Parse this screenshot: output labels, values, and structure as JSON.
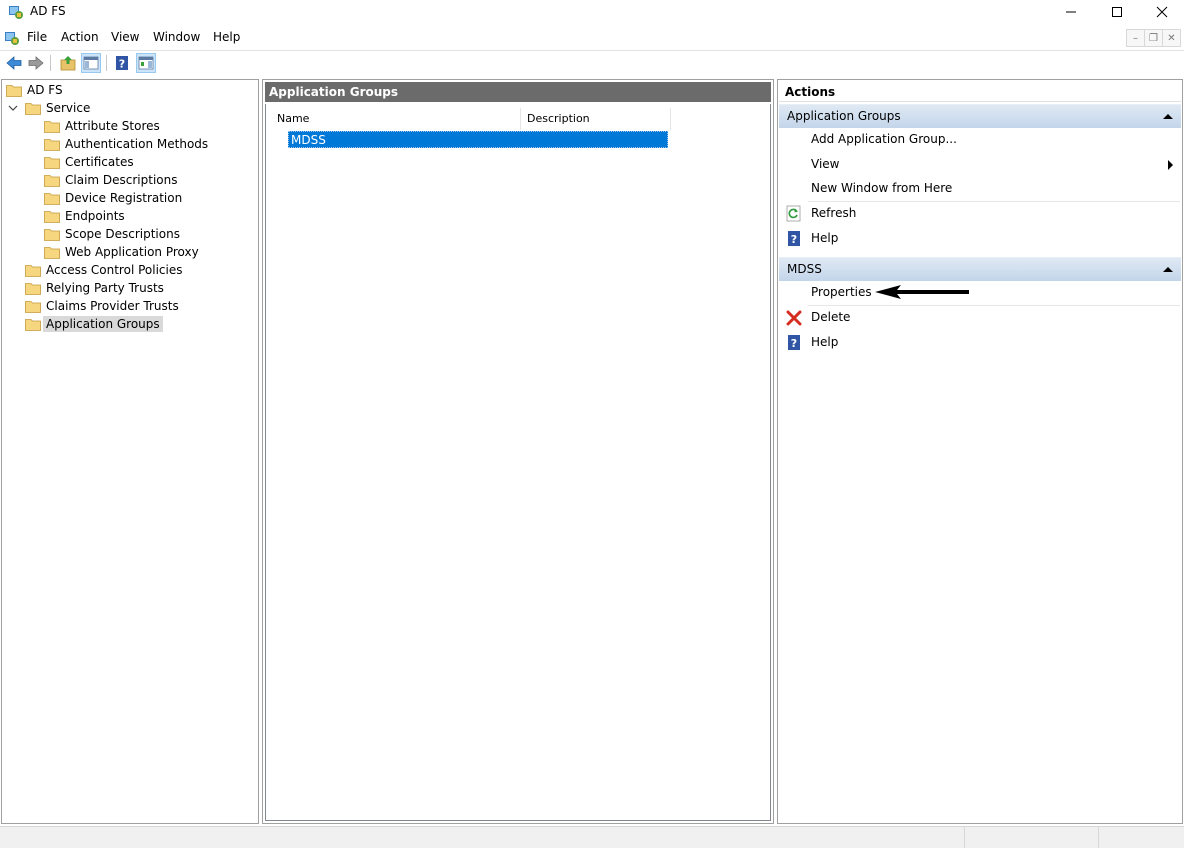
{
  "window": {
    "title": "AD FS",
    "icon": "adfs-icon",
    "controls": [
      "minimize-icon",
      "maximize-icon",
      "close-icon"
    ]
  },
  "menu": {
    "items": [
      "File",
      "Action",
      "View",
      "Window",
      "Help"
    ]
  },
  "toolbar": {
    "buttons": [
      "back-arrow-icon",
      "forward-arrow-icon",
      "up-folder-icon",
      "show-hide-tree-icon",
      "help-icon",
      "show-hide-action-pane-icon"
    ]
  },
  "tree": {
    "root": "AD FS",
    "service": "Service",
    "service_children": [
      "Attribute Stores",
      "Authentication Methods",
      "Certificates",
      "Claim Descriptions",
      "Device Registration",
      "Endpoints",
      "Scope Descriptions",
      "Web Application Proxy"
    ],
    "top_level": [
      "Access Control Policies",
      "Relying Party Trusts",
      "Claims Provider Trusts",
      "Application Groups"
    ],
    "selected": "Application Groups"
  },
  "center": {
    "header": "Application Groups",
    "columns": [
      "Name",
      "Description"
    ],
    "rows": [
      {
        "name": "MDSS",
        "description": ""
      }
    ]
  },
  "actions": {
    "title": "Actions",
    "section1": {
      "title": "Application Groups",
      "items": [
        "Add Application Group...",
        "View",
        "New Window from Here",
        "Refresh",
        "Help"
      ]
    },
    "section2": {
      "title": "MDSS",
      "items": [
        "Properties",
        "Delete",
        "Help"
      ]
    }
  },
  "colors": {
    "selection": "#0078d7",
    "section_header": "#c3d5ea",
    "center_header": "#6b6b6b"
  }
}
